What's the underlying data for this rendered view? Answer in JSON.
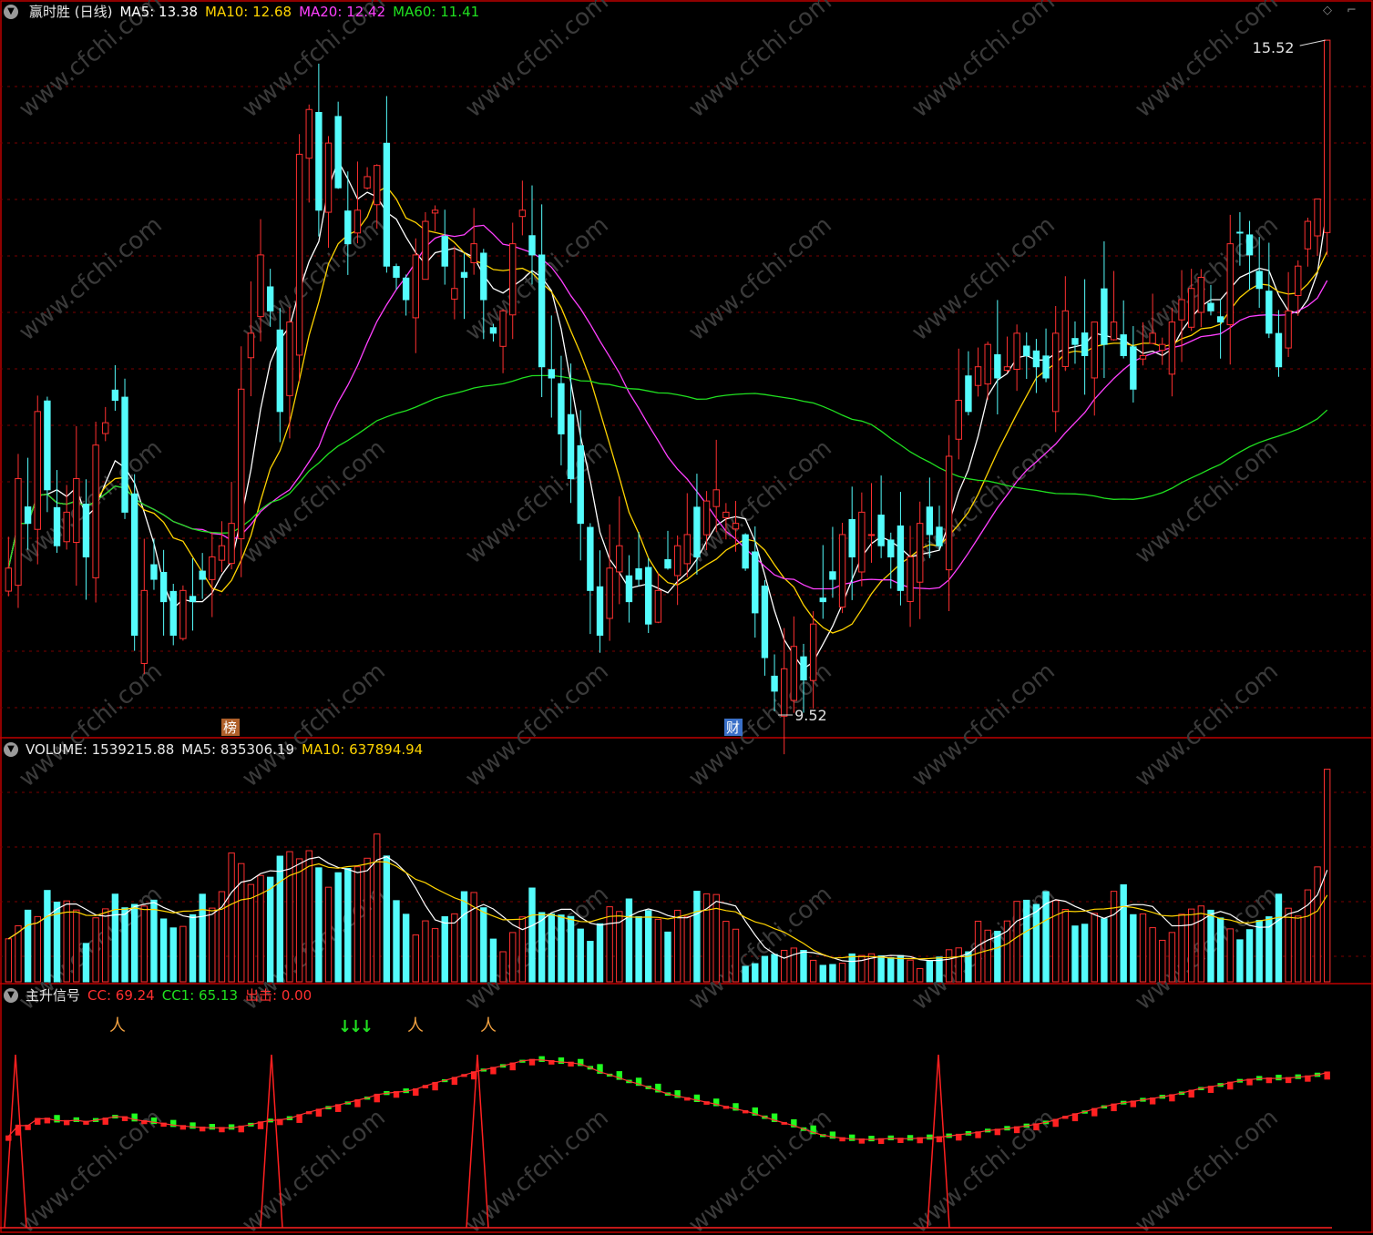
{
  "main_panel": {
    "title": "赢时胜 (日线)",
    "legend": [
      {
        "label": "MA5: 13.38",
        "color": "#ffffff"
      },
      {
        "label": "MA10: 12.68",
        "color": "#ffd400"
      },
      {
        "label": "MA20: 12.42",
        "color": "#ff40ff"
      },
      {
        "label": "MA60: 11.41",
        "color": "#20e020"
      }
    ],
    "high_label": "15.52",
    "low_label": "9.52",
    "markers": [
      {
        "text": "榜",
        "color": "#b0602a"
      },
      {
        "text": "财",
        "color": "#3a70c8"
      }
    ],
    "watermark": "www.cfchi.com"
  },
  "volume_panel": {
    "legend": [
      {
        "label": "VOLUME: 1539215.88",
        "color": "#e8e8e8"
      },
      {
        "label": "MA5: 835306.19",
        "color": "#e8e8e8"
      },
      {
        "label": "MA10: 637894.94",
        "color": "#ffd400"
      }
    ]
  },
  "signal_panel": {
    "title": "主升信号",
    "legend": [
      {
        "label": "CC: 69.24",
        "color": "#ff3030"
      },
      {
        "label": "CC1: 65.13",
        "color": "#20e020"
      },
      {
        "label": "出击: 0.00",
        "color": "#ff3030"
      }
    ]
  },
  "colors": {
    "up": "#ff3030",
    "down": "#54fcfc",
    "grid": "#7a0000",
    "border": "#c00000"
  },
  "icons": {
    "collapse": "chevron-down-icon",
    "settings": "diamond-icon",
    "zoom": "corner-icon"
  },
  "chart_data": {
    "type": "candlestick",
    "series_close": [
      10.8,
      11.6,
      11.2,
      12.2,
      11.5,
      11.0,
      11.3,
      11.6,
      10.9,
      11.9,
      12.1,
      12.3,
      11.3,
      10.2,
      10.6,
      10.7,
      10.5,
      10.2,
      10.6,
      10.5,
      10.7,
      10.9,
      11.0,
      11.2,
      12.4,
      12.9,
      13.6,
      13.1,
      12.2,
      13.0,
      14.5,
      14.9,
      14.0,
      14.6,
      14.2,
      13.7,
      14.0,
      14.3,
      14.4,
      13.5,
      13.4,
      13.2,
      13.6,
      13.9,
      14.0,
      13.5,
      13.3,
      13.4,
      13.7,
      13.2,
      12.9,
      13.1,
      13.7,
      14.0,
      13.6,
      12.6,
      12.5,
      12.0,
      11.6,
      11.2,
      10.6,
      10.2,
      10.8,
      11.0,
      10.5,
      10.7,
      10.3,
      10.6,
      10.8,
      11.0,
      11.1,
      10.9,
      11.4,
      11.5,
      11.3,
      11.2,
      10.8,
      10.4,
      10.0,
      9.7,
      9.9,
      10.1,
      9.8,
      10.3,
      10.5,
      10.7,
      11.1,
      10.9,
      11.3,
      11.1,
      11.0,
      10.9,
      10.6,
      10.9,
      11.2,
      11.1,
      11.0,
      11.8,
      12.3,
      12.2,
      12.6,
      12.8,
      12.5,
      12.6,
      12.9,
      12.7,
      12.6,
      12.5,
      12.9,
      13.1,
      12.8,
      12.7,
      13.0,
      12.8,
      13.0,
      12.7,
      12.4,
      12.7,
      12.9,
      12.8,
      13.0,
      13.2,
      13.3,
      13.4,
      13.1,
      13.0,
      13.7,
      13.8,
      13.6,
      13.3,
      12.9,
      12.6,
      13.1,
      13.5,
      13.9,
      14.1,
      15.52
    ]
  }
}
